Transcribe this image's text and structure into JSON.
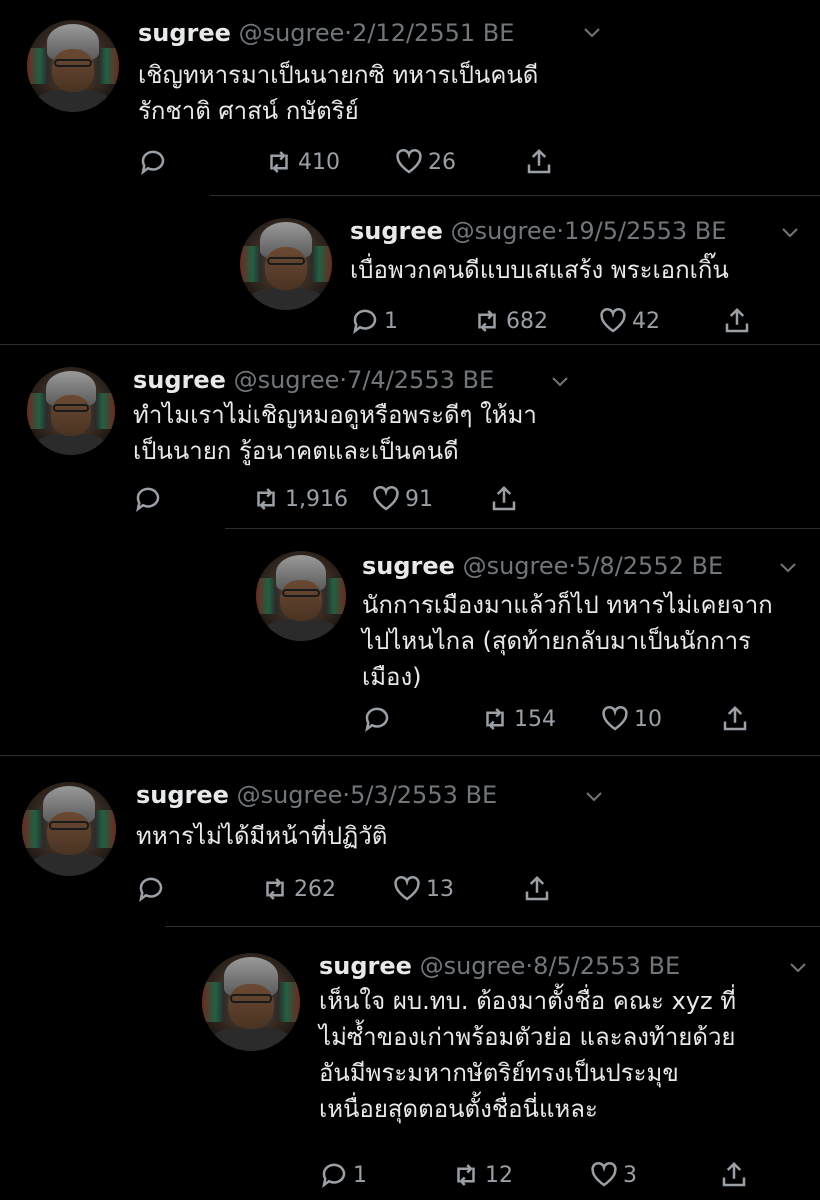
{
  "tweets": [
    {
      "user": "sugree",
      "handle": "@sugree",
      "sep": "·",
      "date": "2/12/2551 BE",
      "text": "เชิญทหารมาเป็นนายกซิ ทหารเป็นคนดี\nรักชาติ ศาสน์ กษัตริย์",
      "replies": "",
      "retweets": "410",
      "likes": "26"
    },
    {
      "user": "sugree",
      "handle": "@sugree",
      "sep": "·",
      "date": "19/5/2553 BE",
      "text": "เบื่อพวกคนดีแบบเสแสร้ง พระเอกเกิ๊น",
      "replies": "1",
      "retweets": "682",
      "likes": "42"
    },
    {
      "user": "sugree",
      "handle": "@sugree",
      "sep": "·",
      "date": "7/4/2553 BE",
      "text": "ทำไมเราไม่เชิญหมอดูหรือพระดีๆ ให้มา\nเป็นนายก รู้อนาคตและเป็นคนดี",
      "replies": "",
      "retweets": "1,916",
      "likes": "91"
    },
    {
      "user": "sugree",
      "handle": "@sugree",
      "sep": "·",
      "date": "5/8/2552 BE",
      "text": "นักการเมืองมาแล้วก็ไป ทหารไม่เคยจาก\nไปไหนไกล (สุดท้ายกลับมาเป็นนักการ\nเมือง)",
      "replies": "",
      "retweets": "154",
      "likes": "10"
    },
    {
      "user": "sugree",
      "handle": "@sugree",
      "sep": "·",
      "date": "5/3/2553 BE",
      "text": "ทหารไม่ได้มีหน้าที่ปฏิวัติ",
      "replies": "",
      "retweets": "262",
      "likes": "13"
    },
    {
      "user": "sugree",
      "handle": "@sugree",
      "sep": "·",
      "date": "8/5/2553 BE",
      "text": "เห็นใจ ผบ.ทบ. ต้องมาตั้งชื่อ คณะ xyz ที่\nไม่ซ้ำของเก่าพร้อมตัวย่อ และลงท้ายด้วย\nอันมีพระมหากษัตริย์ทรงเป็นประมุข\nเหนื่อยสุดตอนตั้งชื่อนี่แหละ",
      "replies": "1",
      "retweets": "12",
      "likes": "3"
    }
  ],
  "icons": {
    "reply": "reply-icon",
    "retweet": "retweet-icon",
    "like": "heart-icon",
    "share": "share-icon",
    "menu": "chevron-down-icon"
  },
  "colors": {
    "background": "#000000",
    "text": "#e7e9ea",
    "muted": "#71767b",
    "icon": "#9aa0a6",
    "separator": "#2a2f33"
  }
}
